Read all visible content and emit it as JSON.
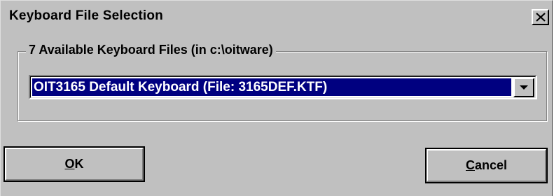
{
  "window": {
    "title": "Keyboard File Selection"
  },
  "group": {
    "label": "7 Available Keyboard Files (in c:\\oitware)"
  },
  "combo": {
    "selected": "OIT3165 Default Keyboard (File: 3165DEF.KTF)"
  },
  "buttons": {
    "ok_mnemonic": "O",
    "ok_rest": "K",
    "cancel_mnemonic": "C",
    "cancel_rest": "ancel"
  },
  "icons": {
    "close": "close-icon",
    "dropdown": "chevron-down-icon"
  },
  "colors": {
    "face": "#c0c0c0",
    "selection": "#000080"
  }
}
